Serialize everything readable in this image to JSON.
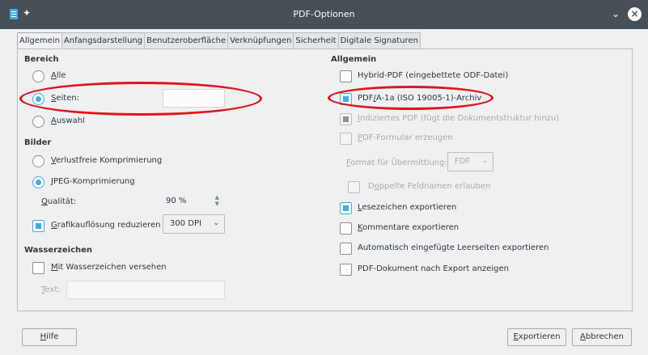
{
  "window": {
    "title": "PDF-Optionen"
  },
  "tabs": [
    "Allgemein",
    "Anfangsdarstellung",
    "Benutzeroberfläche",
    "Verknüpfungen",
    "Sicherheit",
    "Digitale Signaturen"
  ],
  "left": {
    "bereich": {
      "heading": "Bereich",
      "alle": {
        "mn": "A",
        "rest": "lle"
      },
      "seiten": {
        "mn": "S",
        "rest": "eiten:",
        "value": ""
      },
      "auswahl": {
        "mn": "A",
        "rest": "uswahl"
      }
    },
    "bilder": {
      "heading": "Bilder",
      "verlustfrei": {
        "mn": "V",
        "rest": "erlustfreie Komprimierung"
      },
      "jpeg": {
        "mn": "J",
        "rest": "PEG-Komprimierung"
      },
      "qualitaet": {
        "mn": "Q",
        "rest": "ualität:",
        "value": "90 %"
      },
      "aufloesung": {
        "mn": "G",
        "rest": "rafikauflösung reduzieren",
        "value": "300 DPI"
      }
    },
    "wasserzeichen": {
      "heading": "Wasserzeichen",
      "mit": {
        "mn": "M",
        "rest": "it Wasserzeichen versehen"
      },
      "text": {
        "mn": "T",
        "rest": "ext:",
        "value": ""
      }
    }
  },
  "right": {
    "heading": "Allgemein",
    "hybrid": "Hybrid-PDF (eingebettete ODF-Datei)",
    "pdfa": {
      "pre": "PDF",
      "mn": "/",
      "rest": "A-1a (ISO 19005-1)-Archiv"
    },
    "indiziert": {
      "mn": "I",
      "rest": "ndiziertes PDF (fügt die Dokumentstruktur hinzu)"
    },
    "formular": {
      "mn": "P",
      "rest": "DF-Formular erzeugen"
    },
    "format": {
      "mn": "F",
      "rest": "ormat für Übermittlung:",
      "value": "FDF"
    },
    "doppelte": {
      "pre": "D",
      "mn": "o",
      "rest": "ppelte Feldnamen erlauben"
    },
    "lesezeichen": {
      "mn": "L",
      "rest": "esezeichen exportieren"
    },
    "kommentare": {
      "mn": "K",
      "rest": "ommentare exportieren"
    },
    "leerseiten": "Automatisch eingefügte Leerseiten exportieren",
    "anzeigen": "PDF-Dokument nach Export anzeigen"
  },
  "buttons": {
    "hilfe": {
      "mn": "H",
      "rest": "ilfe"
    },
    "exportieren": {
      "mn": "E",
      "rest": "xportieren"
    },
    "abbrechen": {
      "mn": "A",
      "rest": "bbrechen"
    }
  },
  "icons": {
    "pin": "pin-icon",
    "chevron": "chevron-down-icon",
    "close": "close-icon"
  },
  "colors": {
    "accent": "#3daee9",
    "annotation": "#e0141e",
    "titlebar": "#475057"
  }
}
